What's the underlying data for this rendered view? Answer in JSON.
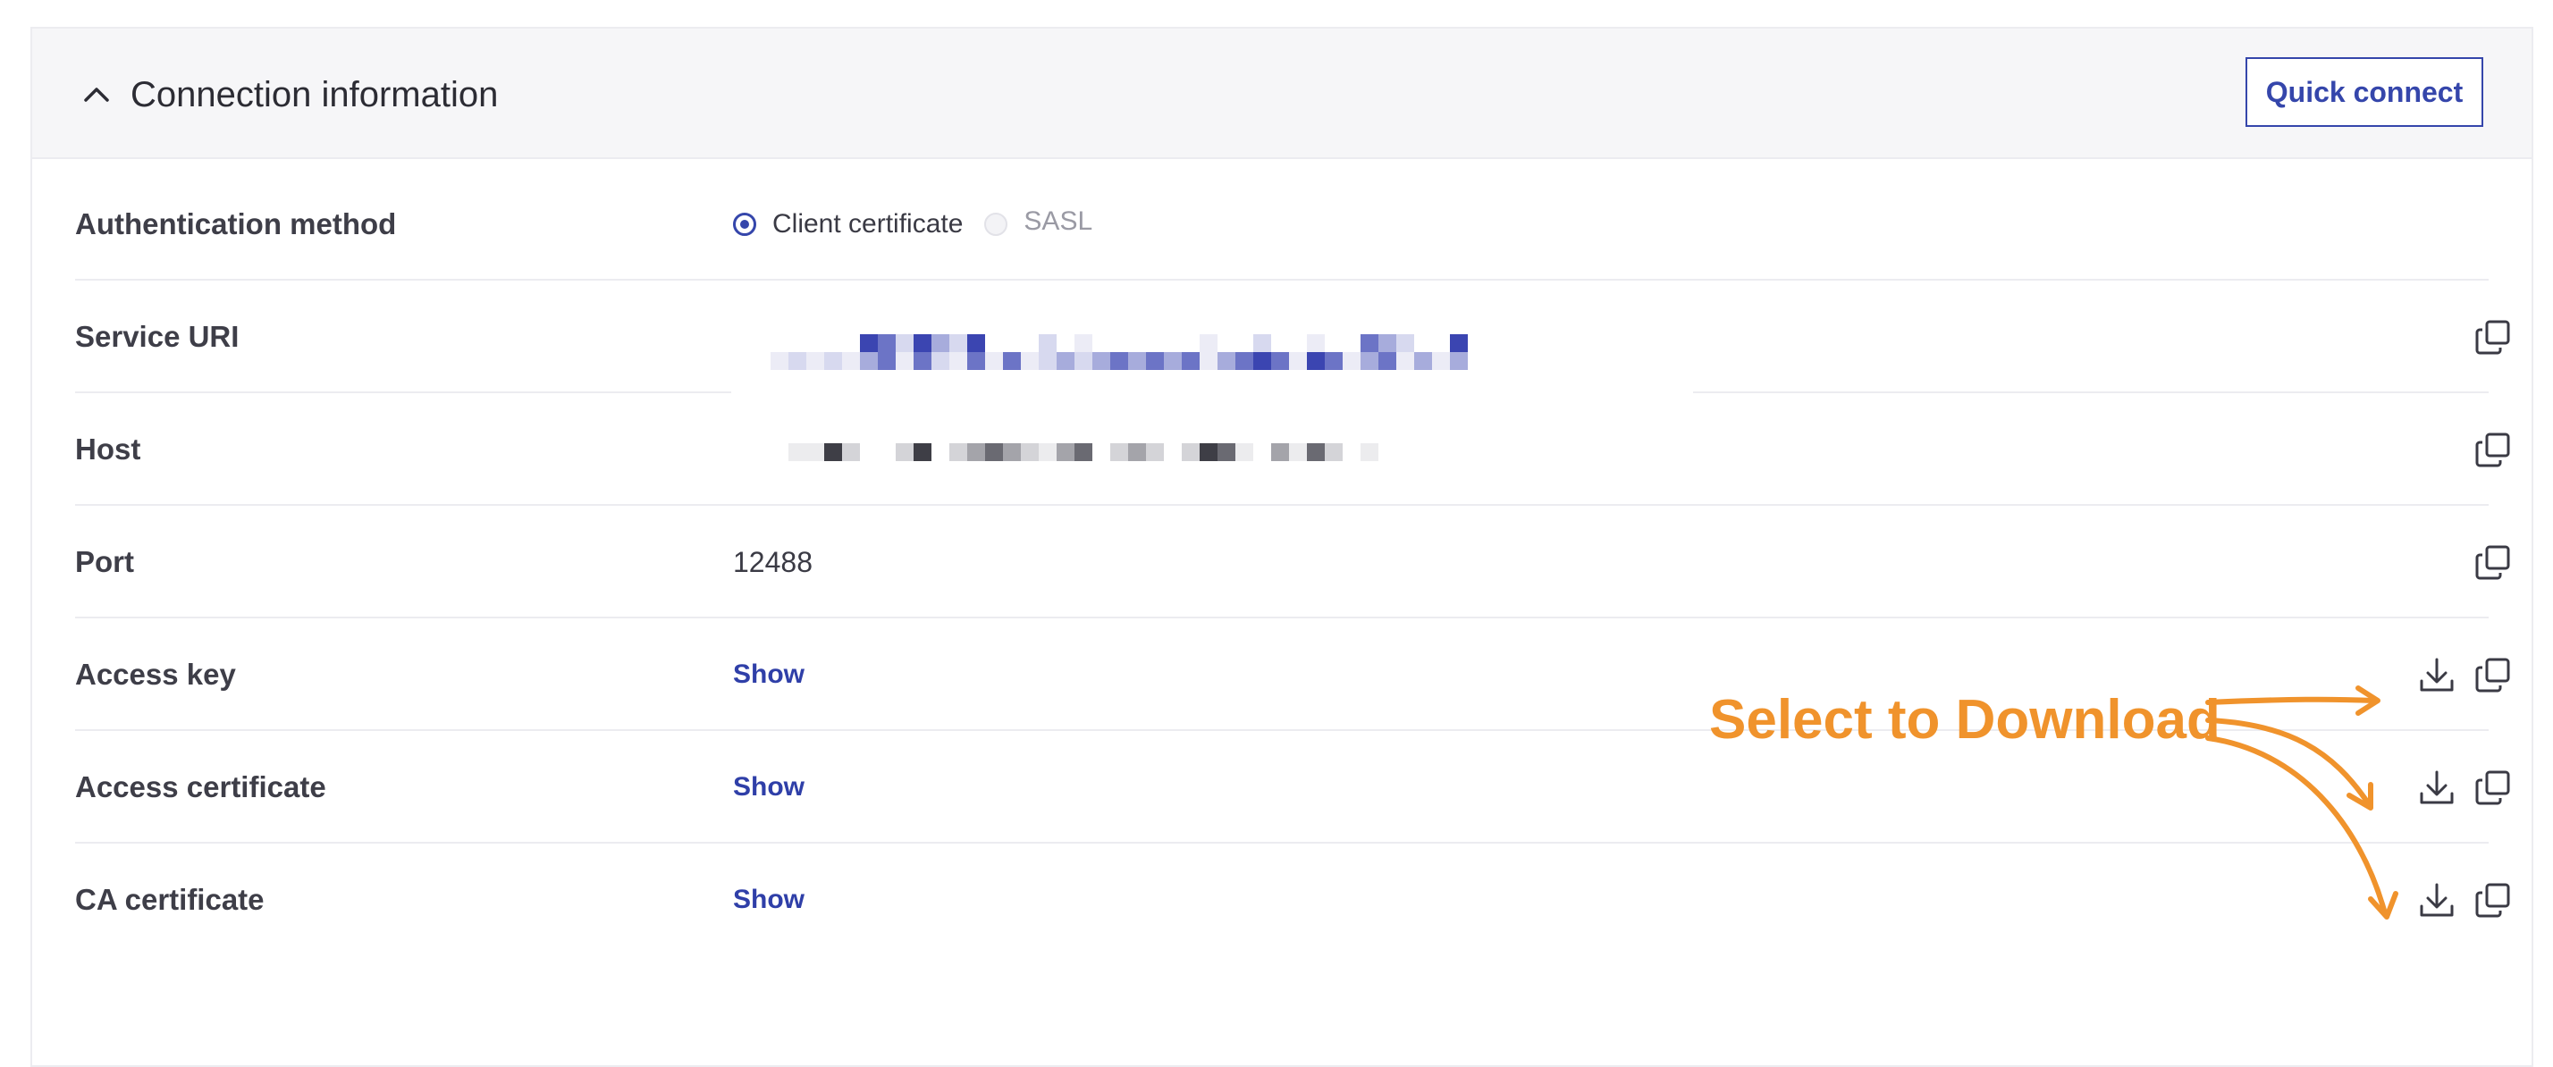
{
  "header": {
    "title": "Connection information",
    "quick_connect_label": "Quick connect"
  },
  "rows": [
    {
      "label": "Authentication method",
      "type": "radio",
      "options": [
        {
          "label": "Client certificate",
          "selected": true,
          "disabled": false
        },
        {
          "label": "SASL",
          "selected": false,
          "disabled": true
        }
      ]
    },
    {
      "label": "Service URI",
      "type": "redacted",
      "icons": [
        "copy-icon"
      ]
    },
    {
      "label": "Host",
      "type": "redacted",
      "icons": [
        "copy-icon"
      ]
    },
    {
      "label": "Port",
      "type": "text",
      "value": "12488",
      "icons": [
        "copy-icon"
      ]
    },
    {
      "label": "Access key",
      "type": "link",
      "value": "Show",
      "icons": [
        "download-icon",
        "copy-icon"
      ]
    },
    {
      "label": "Access certificate",
      "type": "link",
      "value": "Show",
      "icons": [
        "download-icon",
        "copy-icon"
      ]
    },
    {
      "label": "CA certificate",
      "type": "link",
      "value": "Show",
      "icons": [
        "download-icon",
        "copy-icon"
      ]
    }
  ],
  "annotation": {
    "text": "Select to Download",
    "color": "#f0932c"
  },
  "colors": {
    "accent": "#3546ab",
    "annotation": "#f0932c",
    "header_bg": "#f6f6f8"
  }
}
